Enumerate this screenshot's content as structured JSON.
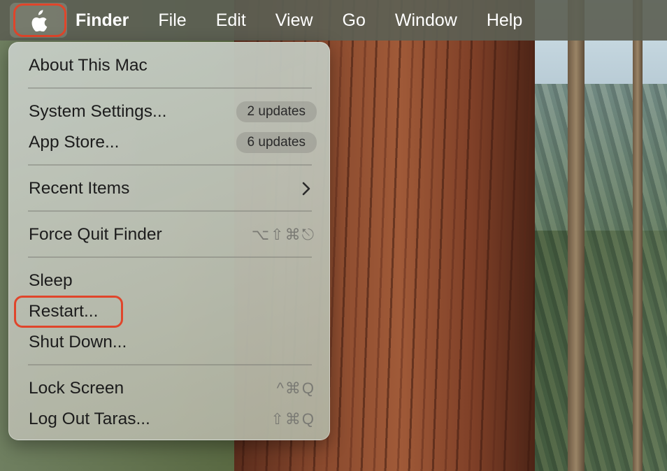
{
  "menubar": {
    "apple_icon": "apple-logo-icon",
    "app_name": "Finder",
    "menus": [
      "File",
      "Edit",
      "View",
      "Go",
      "Window",
      "Help"
    ]
  },
  "apple_menu": {
    "about": "About This Mac",
    "system_settings": {
      "label": "System Settings...",
      "badge": "2 updates"
    },
    "app_store": {
      "label": "App Store...",
      "badge": "6 updates"
    },
    "recent_items": {
      "label": "Recent Items",
      "icon": "chevron-right-icon"
    },
    "force_quit": {
      "label": "Force Quit Finder",
      "shortcut": "⌥⇧⌘⎋"
    },
    "sleep": "Sleep",
    "restart": "Restart...",
    "shut_down": "Shut Down...",
    "lock_screen": {
      "label": "Lock Screen",
      "shortcut": "^⌘Q"
    },
    "log_out": {
      "label": "Log Out Taras...",
      "shortcut": "⇧⌘Q"
    }
  },
  "colors": {
    "annotation": "#e0452b",
    "menubar_text": "#ffffff"
  }
}
